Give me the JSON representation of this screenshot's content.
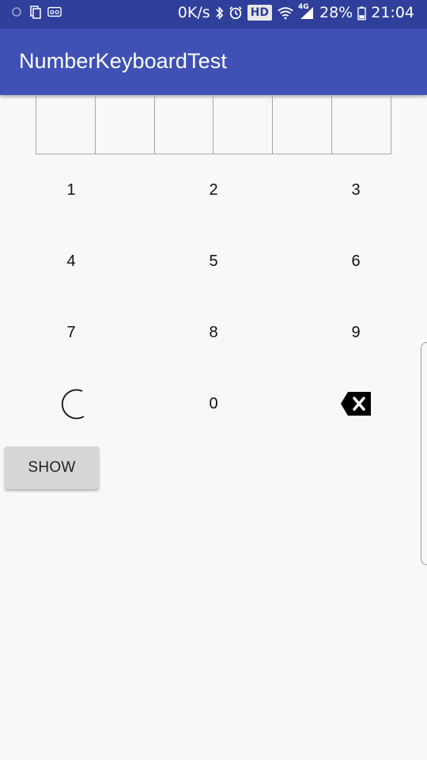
{
  "status_bar": {
    "network_speed": "0K/s",
    "hd_label": "HD",
    "signal_label": "4G",
    "battery": "28%",
    "time": "21:04",
    "icons": [
      "notification-icon",
      "file-icon",
      "voicemail-icon",
      "bluetooth-icon",
      "alarm-icon",
      "wifi-icon",
      "signal-icon",
      "battery-icon"
    ]
  },
  "app_bar": {
    "title": "NumberKeyboardTest",
    "color": "#3f51b5"
  },
  "pin_cells": [
    "",
    "",
    "",
    "",
    "",
    ""
  ],
  "keypad": {
    "keys": [
      "1",
      "2",
      "3",
      "4",
      "5",
      "6",
      "7",
      "8",
      "9",
      "0"
    ],
    "left_action_icon": "spinner-icon",
    "right_action_icon": "backspace-icon"
  },
  "show_button": {
    "label": "SHOW"
  }
}
